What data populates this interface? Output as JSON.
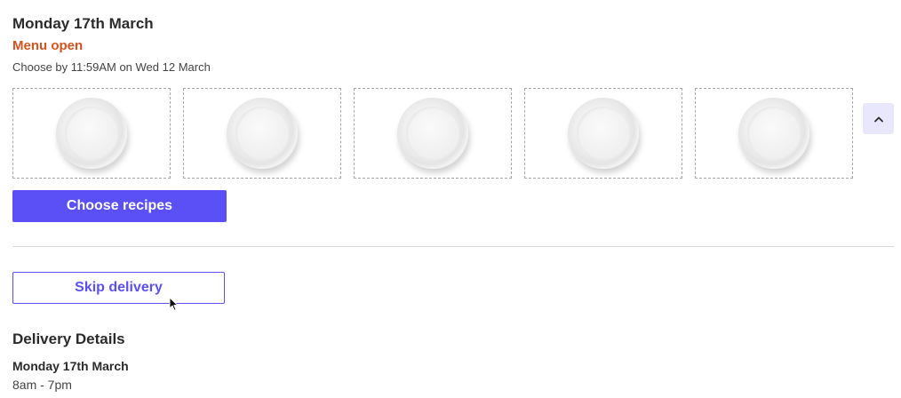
{
  "delivery": {
    "date_title": "Monday 17th March",
    "menu_status": "Menu open",
    "choose_by": "Choose by 11:59AM on Wed 12 March"
  },
  "recipe_slots": [
    {
      "icon": "empty-plate-icon"
    },
    {
      "icon": "empty-plate-icon"
    },
    {
      "icon": "empty-plate-icon"
    },
    {
      "icon": "empty-plate-icon"
    },
    {
      "icon": "empty-plate-icon"
    }
  ],
  "buttons": {
    "choose_recipes": "Choose recipes",
    "skip_delivery": "Skip delivery",
    "collapse_icon": "chevron-up-icon"
  },
  "details": {
    "heading": "Delivery Details",
    "date": "Monday 17th March",
    "time": "8am - 7pm"
  },
  "colors": {
    "accent": "#5a50f5",
    "status": "#d4531f"
  }
}
